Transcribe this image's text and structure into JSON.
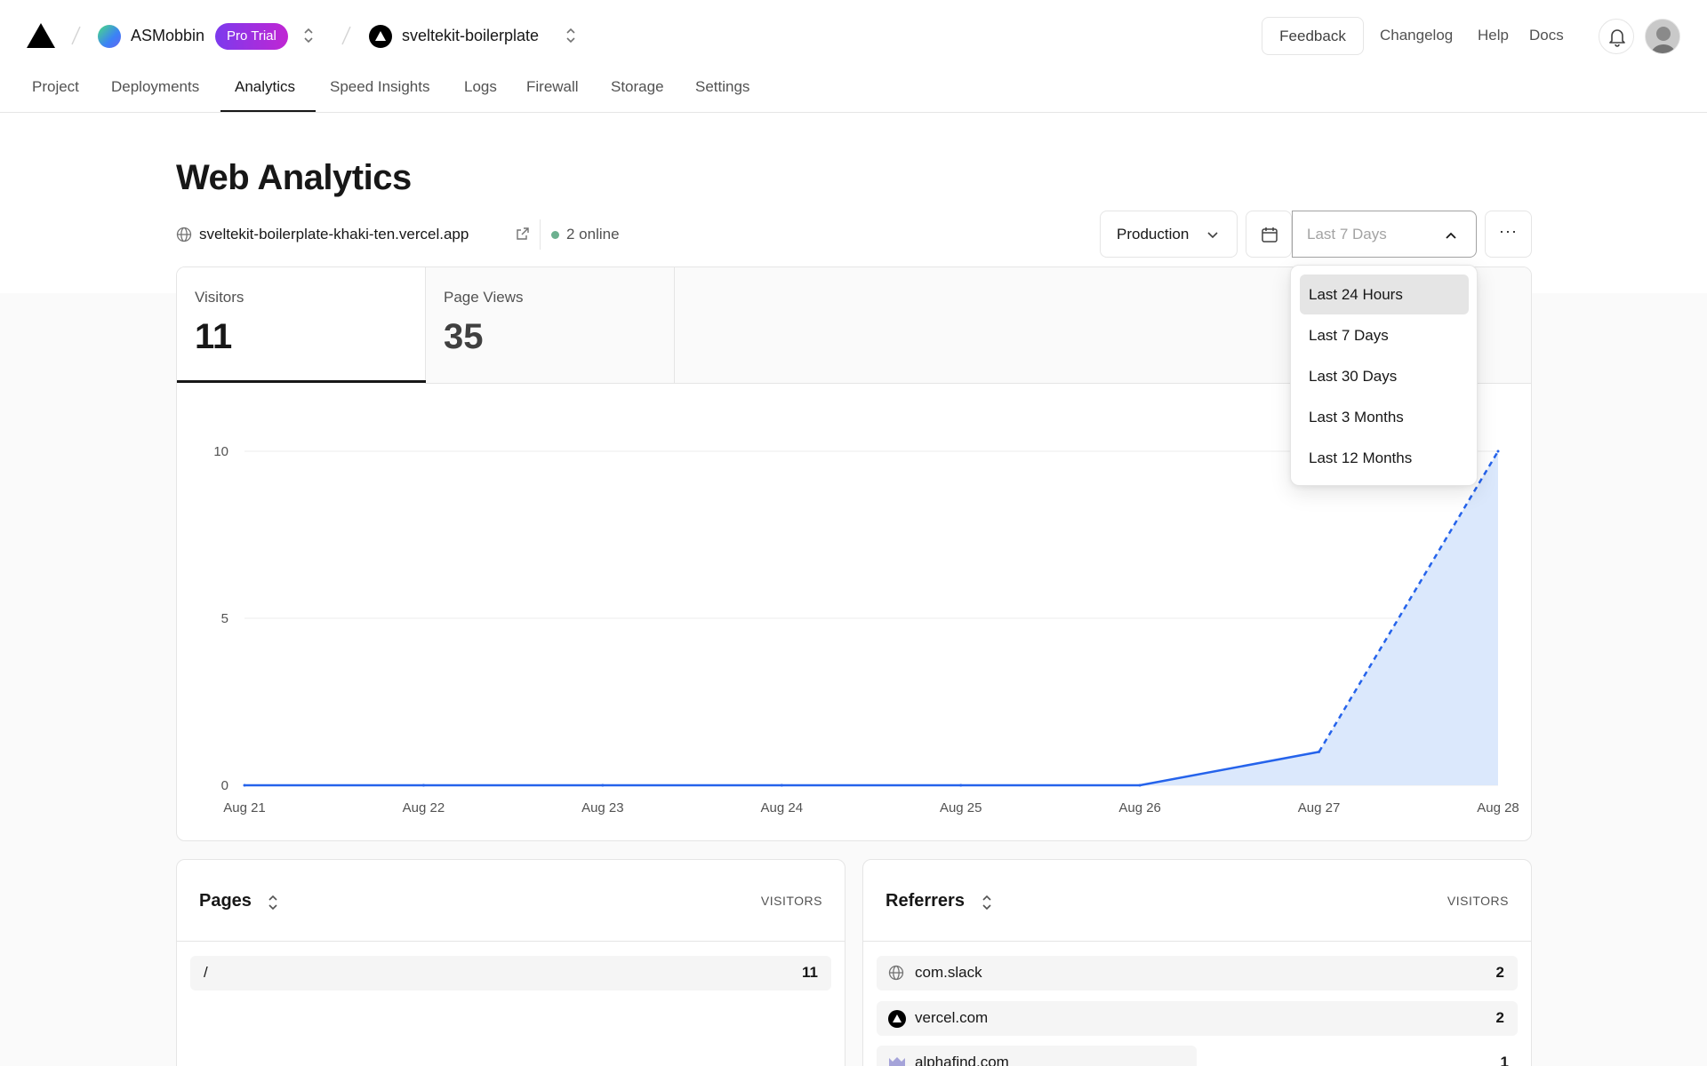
{
  "header": {
    "team_name": "ASMobbin",
    "plan_badge": "Pro Trial",
    "project_name": "sveltekit-boilerplate",
    "links": {
      "feedback": "Feedback",
      "changelog": "Changelog",
      "help": "Help",
      "docs": "Docs"
    }
  },
  "tabs": [
    {
      "label": "Project"
    },
    {
      "label": "Deployments"
    },
    {
      "label": "Analytics",
      "active": true
    },
    {
      "label": "Speed Insights"
    },
    {
      "label": "Logs"
    },
    {
      "label": "Firewall"
    },
    {
      "label": "Storage"
    },
    {
      "label": "Settings"
    }
  ],
  "page": {
    "title": "Web Analytics",
    "domain": "sveltekit-boilerplate-khaki-ten.vercel.app",
    "online": "2 online"
  },
  "controls": {
    "environment": "Production",
    "range_placeholder": "Last 7 Days",
    "more": "···"
  },
  "dropdown": {
    "options": [
      "Last 24 Hours",
      "Last 7 Days",
      "Last 30 Days",
      "Last 3 Months",
      "Last 12 Months"
    ],
    "highlighted": "Last 24 Hours"
  },
  "metrics": [
    {
      "label": "Visitors",
      "value": "11",
      "selected": true
    },
    {
      "label": "Page Views",
      "value": "35"
    }
  ],
  "chart_data": {
    "type": "area",
    "x": [
      "Aug 21",
      "Aug 22",
      "Aug 23",
      "Aug 24",
      "Aug 25",
      "Aug 26",
      "Aug 27",
      "Aug 28"
    ],
    "series": [
      {
        "values": [
          0,
          0,
          0,
          0,
          0,
          0,
          1,
          10
        ],
        "dashed_from_index": 6
      }
    ],
    "yticks": [
      0,
      5,
      10
    ],
    "ylim": [
      0,
      10
    ],
    "grid": true,
    "line_color": "#2563eb",
    "fill_color": "#dbe8fc"
  },
  "pages_panel": {
    "title": "Pages",
    "column": "VISITORS",
    "rows": [
      {
        "label": "/",
        "value": "11"
      }
    ]
  },
  "referrers_panel": {
    "title": "Referrers",
    "column": "VISITORS",
    "rows": [
      {
        "label": "com.slack",
        "value": "2",
        "icon": "globe-icon"
      },
      {
        "label": "vercel.com",
        "value": "2",
        "icon": "vercel-icon"
      },
      {
        "label": "alphafind.com",
        "value": "1",
        "icon": "site-icon"
      }
    ]
  }
}
